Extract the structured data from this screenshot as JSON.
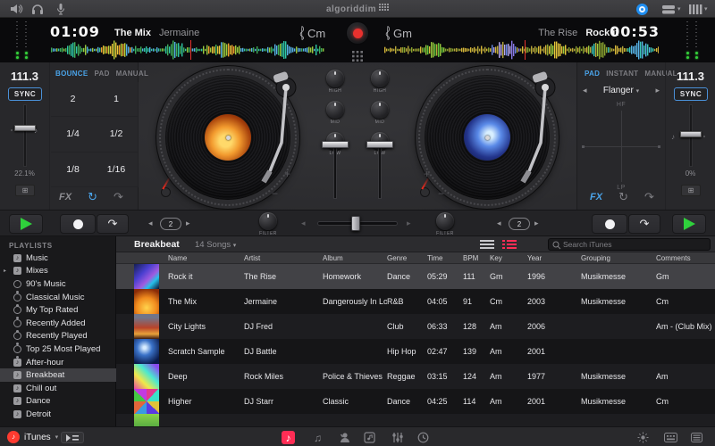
{
  "colors": {
    "accent_blue": "#4aa3e8",
    "accent_red": "#ff2d55",
    "accent_green": "#2fd13c",
    "playhead_red": "#e8312e"
  },
  "topbar": {
    "logo": "algoriddim"
  },
  "wave_row": {
    "deck_a": {
      "time": "01:09",
      "title": "The Mix",
      "artist": "Jermaine",
      "key": "Cm"
    },
    "deck_b": {
      "time": "00:53",
      "title": "Rock it",
      "artist": "The Rise",
      "key": "Gm"
    }
  },
  "deck_a_panel": {
    "bpm": "111.3",
    "sync": "SYNC",
    "tempo_pct": "22.1%",
    "tabs": [
      {
        "label": "BOUNCE",
        "active": true
      },
      {
        "label": "PAD"
      },
      {
        "label": "MANUAL"
      }
    ],
    "pads": [
      "2",
      "1",
      "1/4",
      "1/2",
      "1/8",
      "1/16"
    ],
    "fx_label": "FX"
  },
  "deck_b_panel": {
    "bpm": "111.3",
    "sync": "SYNC",
    "tempo_pct": "0%",
    "tabs": [
      {
        "label": "PAD",
        "active": true
      },
      {
        "label": "INSTANT"
      },
      {
        "label": "MANUAL"
      }
    ],
    "effect": "Flanger",
    "xy_top": "HF",
    "xy_bottom": "LP",
    "fx_label": "FX"
  },
  "mixer": {
    "eq_labels": [
      "HIGH",
      "MID",
      "LOW"
    ],
    "filter_label": "FILTER",
    "loop_a": "2",
    "loop_b": "2"
  },
  "sidebar": {
    "header": "PLAYLISTS",
    "items": [
      {
        "label": "Music",
        "type": "library"
      },
      {
        "label": "Mixes",
        "type": "library",
        "disclosure": true
      },
      {
        "label": "90's Music",
        "type": "smart"
      },
      {
        "label": "Classical Music",
        "type": "smart"
      },
      {
        "label": "My Top Rated",
        "type": "smart"
      },
      {
        "label": "Recently Added",
        "type": "smart"
      },
      {
        "label": "Recently Played",
        "type": "smart"
      },
      {
        "label": "Top 25 Most Played",
        "type": "smart"
      },
      {
        "label": "After-hour",
        "type": "playlist"
      },
      {
        "label": "Breakbeat",
        "type": "playlist",
        "selected": true
      },
      {
        "label": "Chill out",
        "type": "playlist"
      },
      {
        "label": "Dance",
        "type": "playlist"
      },
      {
        "label": "Detroit",
        "type": "playlist"
      }
    ],
    "source": "iTunes"
  },
  "browser": {
    "title": "Breakbeat",
    "subtitle": "14 Songs",
    "search_placeholder": "Search iTunes",
    "columns": [
      "Name",
      "Artist",
      "Album",
      "Genre",
      "Time",
      "BPM",
      "Key",
      "Year",
      "Grouping",
      "Comments"
    ],
    "tracks": [
      {
        "name": "Rock it",
        "artist": "The Rise",
        "album": "Homework",
        "genre": "Dance",
        "time": "05:29",
        "bpm": "111",
        "key": "Gm",
        "year": "1996",
        "grouping": "Musikmesse",
        "comments": "Gm",
        "selected": true,
        "art": "art-rockit"
      },
      {
        "name": "The Mix",
        "artist": "Jermaine",
        "album": "Dangerously In Love",
        "genre": "R&B",
        "time": "04:05",
        "bpm": "91",
        "key": "Cm",
        "year": "2003",
        "grouping": "Musikmesse",
        "comments": "Cm",
        "art": "art-themix"
      },
      {
        "name": "City Lights",
        "artist": "DJ Fred",
        "album": "",
        "genre": "Club",
        "time": "06:33",
        "bpm": "128",
        "key": "Am",
        "year": "2006",
        "grouping": "",
        "comments": "Am - (Club Mix)",
        "art": "art-citylights"
      },
      {
        "name": "Scratch Sample",
        "artist": "DJ Battle",
        "album": "",
        "genre": "Hip Hop",
        "time": "02:47",
        "bpm": "139",
        "key": "Am",
        "year": "2001",
        "grouping": "",
        "comments": "",
        "art": "art-scratch"
      },
      {
        "name": "Deep",
        "artist": "Rock Miles",
        "album": "Police & Thieves",
        "genre": "Reggae",
        "time": "03:15",
        "bpm": "124",
        "key": "Am",
        "year": "1977",
        "grouping": "Musikmesse",
        "comments": "Am",
        "art": "art-deep"
      },
      {
        "name": "Higher",
        "artist": "DJ Starr",
        "album": "Classic",
        "genre": "Dance",
        "time": "04:25",
        "bpm": "114",
        "key": "Am",
        "year": "2001",
        "grouping": "Musikmesse",
        "comments": "Cm",
        "art": "art-higher"
      }
    ]
  },
  "waveforms": {
    "a": {
      "seed": 7,
      "playhead": 0.51,
      "base": [
        "#3fae5a",
        "#2fc8a8",
        "#58b4e8",
        "#9acb3e"
      ],
      "bursts": [
        {
          "p": 0.08,
          "w": 0.03,
          "c": [
            "#3fae5a",
            "#2fc8a8"
          ]
        },
        {
          "p": 0.23,
          "w": 0.06,
          "c": [
            "#e8c83a",
            "#f0a02e",
            "#b8d23a"
          ]
        },
        {
          "p": 0.45,
          "w": 0.04,
          "c": [
            "#3fae5a",
            "#2fc8a8"
          ]
        },
        {
          "p": 0.63,
          "w": 0.06,
          "c": [
            "#e8c83a",
            "#f0a02e",
            "#9acb3e"
          ]
        },
        {
          "p": 0.85,
          "w": 0.04,
          "c": [
            "#58b4e8",
            "#2fc8a8"
          ]
        }
      ]
    },
    "b": {
      "seed": 13,
      "playhead": 0.51,
      "base": [
        "#b8a83a",
        "#8aa32e",
        "#d8b83a"
      ],
      "bursts": [
        {
          "p": 0.18,
          "w": 0.04,
          "c": [
            "#9acb3e",
            "#5fc83a"
          ]
        },
        {
          "p": 0.44,
          "w": 0.05,
          "c": [
            "#8a7ae8",
            "#b8aaf0",
            "#6a8ae8"
          ]
        },
        {
          "p": 0.62,
          "w": 0.04,
          "c": [
            "#e8c83a",
            "#9acb3e"
          ]
        },
        {
          "p": 0.78,
          "w": 0.04,
          "c": [
            "#3ac8b8",
            "#9acb3e"
          ]
        },
        {
          "p": 0.93,
          "w": 0.05,
          "c": [
            "#58b4e8",
            "#3ac8b8"
          ]
        }
      ]
    }
  }
}
